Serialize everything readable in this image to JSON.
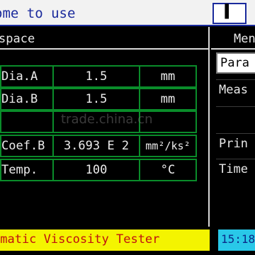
{
  "title_bar": {
    "title": "ome to use",
    "icon": "window-control-icon"
  },
  "workspace": {
    "header": "space",
    "rows": [
      {
        "name": "Dia.A",
        "value": "1.5",
        "unit": "mm"
      },
      {
        "name": "Dia.B",
        "value": "1.5",
        "unit": "mm"
      },
      {
        "name": "",
        "value": "",
        "unit": ""
      },
      {
        "name": "Coef.B",
        "value": "3.693 E 2",
        "unit": "mm²/ks²"
      },
      {
        "name": "Temp.",
        "value": "100",
        "unit": "°C"
      }
    ]
  },
  "watermark": "trade.china.cn",
  "menu": {
    "header": "Men",
    "items": [
      {
        "label": "Para",
        "selected": true
      },
      {
        "label": "Meas",
        "selected": false
      },
      {
        "label": "",
        "selected": false
      },
      {
        "label": "Prin",
        "selected": false
      },
      {
        "label": "Time",
        "selected": false
      }
    ]
  },
  "status": {
    "text": "ematic Viscosity Tester",
    "time": "15:18"
  },
  "colors": {
    "title_text": "#1a2a9c",
    "grid_border": "#0a8c2a",
    "status_bg": "#f4f400",
    "status_text": "#c01010",
    "clock_bg": "#29c8e8"
  }
}
